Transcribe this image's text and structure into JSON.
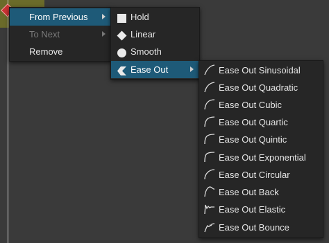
{
  "menu1": {
    "items": [
      {
        "label": "From Previous",
        "state": "highlighted",
        "submenu": true
      },
      {
        "label": "To Next",
        "state": "disabled",
        "submenu": true
      },
      {
        "label": "Remove",
        "state": "normal",
        "submenu": false
      }
    ]
  },
  "menu2": {
    "items": [
      {
        "label": "Hold",
        "icon": "square-icon"
      },
      {
        "label": "Linear",
        "icon": "diamond-icon"
      },
      {
        "label": "Smooth",
        "icon": "circle-icon"
      },
      {
        "label": "Ease Out",
        "icon": "ease-out-icon",
        "state": "highlighted",
        "submenu": true
      }
    ]
  },
  "menu3": {
    "items": [
      {
        "label": "Ease Out Sinusoidal",
        "icon": "ease-sinusoidal-curve-icon"
      },
      {
        "label": "Ease Out Quadratic",
        "icon": "ease-quadratic-curve-icon"
      },
      {
        "label": "Ease Out Cubic",
        "icon": "ease-cubic-curve-icon"
      },
      {
        "label": "Ease Out Quartic",
        "icon": "ease-quartic-curve-icon"
      },
      {
        "label": "Ease Out Quintic",
        "icon": "ease-quintic-curve-icon"
      },
      {
        "label": "Ease Out Exponential",
        "icon": "ease-exponential-curve-icon"
      },
      {
        "label": "Ease Out Circular",
        "icon": "ease-circular-curve-icon"
      },
      {
        "label": "Ease Out Back",
        "icon": "ease-back-curve-icon"
      },
      {
        "label": "Ease Out Elastic",
        "icon": "ease-elastic-curve-icon"
      },
      {
        "label": "Ease Out Bounce",
        "icon": "ease-bounce-curve-icon"
      }
    ]
  },
  "colors": {
    "background": "#3a3a3a",
    "menu": "#262626",
    "highlight": "#1e5a78",
    "text": "#e6e6e6",
    "disabled_text": "#7a7a7a"
  }
}
